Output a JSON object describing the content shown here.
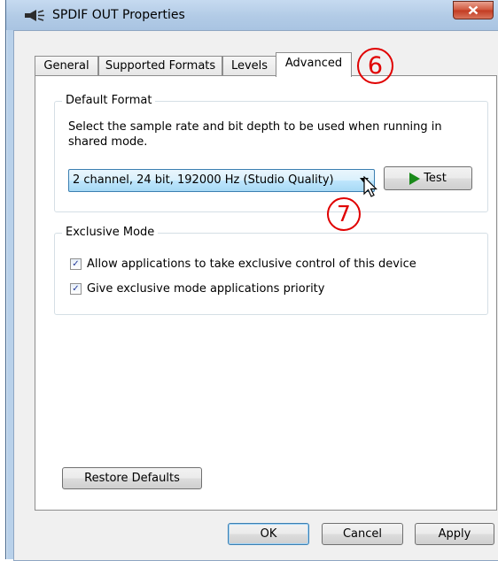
{
  "window": {
    "title": "SPDIF OUT Properties",
    "close_label": "X"
  },
  "tabs": [
    {
      "label": "General",
      "active": false
    },
    {
      "label": "Supported Formats",
      "active": false
    },
    {
      "label": "Levels",
      "active": false
    },
    {
      "label": "Advanced",
      "active": true
    }
  ],
  "annotations": {
    "step6": "6",
    "step7": "7",
    "color": "#e00000"
  },
  "default_format": {
    "title": "Default Format",
    "description": "Select the sample rate and bit depth to be used when running in shared mode.",
    "selected": "2 channel, 24 bit, 192000 Hz (Studio Quality)",
    "test_label": "Test"
  },
  "exclusive_mode": {
    "title": "Exclusive Mode",
    "options": [
      {
        "label": "Allow applications to take exclusive control of this device",
        "checked": true
      },
      {
        "label": "Give exclusive mode applications priority",
        "checked": true
      }
    ]
  },
  "buttons": {
    "restore_defaults": "Restore Defaults",
    "ok": "OK",
    "cancel": "Cancel",
    "apply": "Apply"
  }
}
